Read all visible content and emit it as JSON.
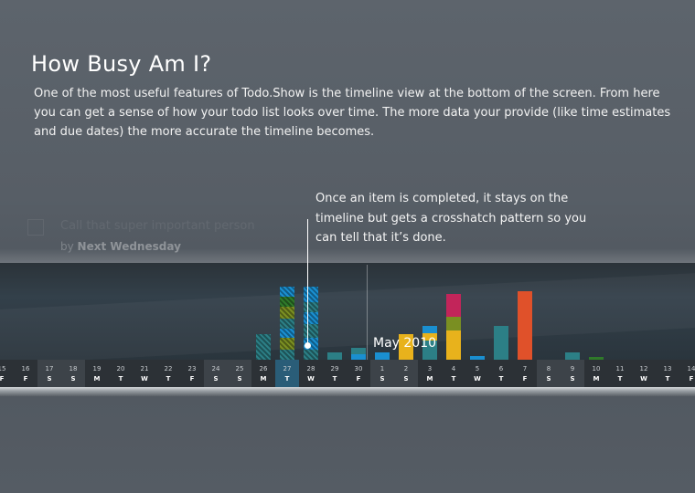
{
  "header": {
    "title": "How Busy Am I?",
    "intro": "One of the most useful features of Todo.Show is the timeline view at the bottom of the screen. From here you can get a sense of how your todo list looks over time. The more data your provide (like time estimates and due dates) the more accurate the timeline becomes."
  },
  "callout": {
    "text": "Once an item is completed, it stays on the timeline but gets a crosshatch pattern so you can tell that it’s done."
  },
  "background_task": {
    "title": "Call that super important person",
    "due_prefix": "by",
    "due_value": "Next Wednesday"
  },
  "timeline": {
    "month_label": "May 2010",
    "days": [
      {
        "num": "15",
        "dow": "F",
        "weekend": false,
        "today": false
      },
      {
        "num": "16",
        "dow": "F",
        "weekend": false,
        "today": false
      },
      {
        "num": "17",
        "dow": "S",
        "weekend": true,
        "today": false
      },
      {
        "num": "18",
        "dow": "S",
        "weekend": true,
        "today": false
      },
      {
        "num": "19",
        "dow": "M",
        "weekend": false,
        "today": false
      },
      {
        "num": "20",
        "dow": "T",
        "weekend": false,
        "today": false
      },
      {
        "num": "21",
        "dow": "W",
        "weekend": false,
        "today": false
      },
      {
        "num": "22",
        "dow": "T",
        "weekend": false,
        "today": false
      },
      {
        "num": "23",
        "dow": "F",
        "weekend": false,
        "today": false
      },
      {
        "num": "24",
        "dow": "S",
        "weekend": true,
        "today": false
      },
      {
        "num": "25",
        "dow": "S",
        "weekend": true,
        "today": false
      },
      {
        "num": "26",
        "dow": "M",
        "weekend": false,
        "today": false
      },
      {
        "num": "27",
        "dow": "T",
        "weekend": false,
        "today": true
      },
      {
        "num": "28",
        "dow": "W",
        "weekend": false,
        "today": false
      },
      {
        "num": "29",
        "dow": "T",
        "weekend": false,
        "today": false
      },
      {
        "num": "30",
        "dow": "F",
        "weekend": false,
        "today": false
      },
      {
        "num": "1",
        "dow": "S",
        "weekend": true,
        "today": false
      },
      {
        "num": "2",
        "dow": "S",
        "weekend": true,
        "today": false
      },
      {
        "num": "3",
        "dow": "M",
        "weekend": false,
        "today": false
      },
      {
        "num": "4",
        "dow": "T",
        "weekend": false,
        "today": false
      },
      {
        "num": "5",
        "dow": "W",
        "weekend": false,
        "today": false
      },
      {
        "num": "6",
        "dow": "T",
        "weekend": false,
        "today": false
      },
      {
        "num": "7",
        "dow": "F",
        "weekend": false,
        "today": false
      },
      {
        "num": "8",
        "dow": "S",
        "weekend": true,
        "today": false
      },
      {
        "num": "9",
        "dow": "S",
        "weekend": true,
        "today": false
      },
      {
        "num": "10",
        "dow": "M",
        "weekend": false,
        "today": false
      },
      {
        "num": "11",
        "dow": "T",
        "weekend": false,
        "today": false
      },
      {
        "num": "12",
        "dow": "W",
        "weekend": false,
        "today": false
      },
      {
        "num": "13",
        "dow": "T",
        "weekend": false,
        "today": false
      },
      {
        "num": "14",
        "dow": "F",
        "weekend": false,
        "today": false
      }
    ],
    "colors": {
      "blue": "#1a8fd0",
      "teal": "#2c7f86",
      "yellow": "#e8b21c",
      "green": "#2f7a2a",
      "olive": "#7a8f22",
      "red": "#e0512a",
      "magenta": "#c2255a"
    },
    "bars": [
      {
        "day_index": 11,
        "done": true,
        "segments": [
          {
            "color": "teal",
            "load": 0.26
          }
        ]
      },
      {
        "day_index": 12,
        "done": true,
        "segments": [
          {
            "color": "teal",
            "load": 0.1
          },
          {
            "color": "olive",
            "load": 0.12
          },
          {
            "color": "blue",
            "load": 0.09
          },
          {
            "color": "teal",
            "load": 0.1
          },
          {
            "color": "olive",
            "load": 0.12
          },
          {
            "color": "green",
            "load": 0.1
          },
          {
            "color": "blue",
            "load": 0.1
          }
        ]
      },
      {
        "day_index": 13,
        "done": true,
        "segments": [
          {
            "color": "teal",
            "load": 0.1
          },
          {
            "color": "blue",
            "load": 0.12
          },
          {
            "color": "teal",
            "load": 0.14
          },
          {
            "color": "blue",
            "load": 0.12
          },
          {
            "color": "teal",
            "load": 0.1
          },
          {
            "color": "blue",
            "load": 0.16
          }
        ]
      },
      {
        "day_index": 14,
        "done": false,
        "segments": [
          {
            "color": "teal",
            "load": 0.08
          }
        ]
      },
      {
        "day_index": 15,
        "done": false,
        "segments": [
          {
            "color": "blue",
            "load": 0.06
          },
          {
            "color": "teal",
            "load": 0.07
          }
        ]
      },
      {
        "day_index": 16,
        "done": false,
        "segments": [
          {
            "color": "blue",
            "load": 0.08
          }
        ]
      },
      {
        "day_index": 17,
        "done": false,
        "segments": [
          {
            "color": "yellow",
            "load": 0.26
          }
        ]
      },
      {
        "day_index": 18,
        "done": false,
        "segments": [
          {
            "color": "teal",
            "load": 0.2
          },
          {
            "color": "yellow",
            "load": 0.08
          },
          {
            "color": "blue",
            "load": 0.08
          }
        ]
      },
      {
        "day_index": 19,
        "done": false,
        "segments": [
          {
            "color": "yellow",
            "load": 0.3
          },
          {
            "color": "olive",
            "load": 0.14
          },
          {
            "color": "magenta",
            "load": 0.24
          }
        ]
      },
      {
        "day_index": 20,
        "done": false,
        "segments": [
          {
            "color": "blue",
            "load": 0.04
          }
        ]
      },
      {
        "day_index": 21,
        "done": false,
        "segments": [
          {
            "color": "teal",
            "load": 0.35
          }
        ]
      },
      {
        "day_index": 22,
        "done": false,
        "segments": [
          {
            "color": "red",
            "load": 0.71
          }
        ]
      },
      {
        "day_index": 24,
        "done": false,
        "segments": [
          {
            "color": "teal",
            "load": 0.08
          }
        ]
      },
      {
        "day_index": 25,
        "done": false,
        "segments": [
          {
            "color": "green",
            "load": 0.03
          }
        ]
      }
    ]
  }
}
